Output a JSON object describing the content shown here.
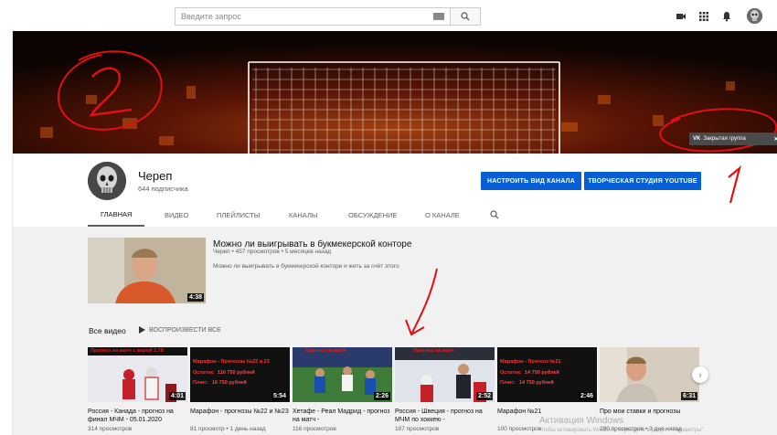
{
  "search": {
    "placeholder": "Введите запрос"
  },
  "icons": {
    "keyboard": "keyboard-icon",
    "search": "search-icon",
    "camera": "video-camera-icon",
    "apps": "apps-grid-icon",
    "bell": "bell-icon"
  },
  "banner": {
    "annotation_number": "2",
    "closed_group": "Закрытая группа"
  },
  "channel": {
    "name": "Череп",
    "subscribers": "644 подписчика",
    "customize_btn": "НАСТРОИТЬ ВИД КАНАЛА",
    "studio_btn": "ТВОРЧЕСКАЯ СТУДИЯ YOUTUBE",
    "annotation_number": "1"
  },
  "tabs": [
    "ГЛАВНАЯ",
    "ВИДЕО",
    "ПЛЕЙЛИСТЫ",
    "КАНАЛЫ",
    "ОБСУЖДЕНИЕ",
    "О КАНАЛЕ"
  ],
  "featured": {
    "title": "Можно ли выигрывать в букмекерской конторе",
    "meta": "Череп • 457 просмотров • 5 месяцев назад",
    "description": "Можно ли выигрывать в букмекерской конторе и жить за счёт этого",
    "duration": "4:38"
  },
  "all_videos": {
    "title": "Все видео",
    "play_all": "ВОСПРОИЗВЕСТИ ВСЕ"
  },
  "videos": [
    {
      "title": "Россия - Канада - прогноз на финал МЧМ - 05.01.2020",
      "meta": "314 просмотров",
      "duration": "4:01",
      "overlay": "Прогноз на матч с вирой 1.78"
    },
    {
      "title": "Марафон - прогнозы №22 и №23",
      "meta": "81 просмотр • 1 день назад",
      "duration": "5:54",
      "overlay": "Марафон - Прогнозы №22 и 23",
      "line1": "Остаток:",
      "val1": "116 750 рублей",
      "line2": "Плюс:",
      "val2": "16 750 рублей"
    },
    {
      "title": "Хетафе - Реал Мадрид - прогноз на матч -",
      "meta": "116 просмотров",
      "duration": "2:26",
      "overlay": "Прогноз на матч"
    },
    {
      "title": "Россия - Швеция - прогноз на МЧМ по хоккею -",
      "meta": "187 просмотров",
      "duration": "2:52",
      "overlay": "Прогноз на матч"
    },
    {
      "title": "Марафон №21",
      "meta": "100 просмотров",
      "duration": "2:46",
      "overlay": "Марафон - Прогноз №21",
      "line1": "Остаток:",
      "val1": "14 750 рублей",
      "line2": "Плюс:",
      "val2": "14 750 рублей"
    },
    {
      "title": "Про мои ставки и прогнозы",
      "meta": "290 просмотров • 3 дня назад",
      "duration": "6:31"
    }
  ],
  "watermark": {
    "line1": "Активация Windows",
    "line2": "Чтобы активировать Windows, перейдите в раздел \"Параметры\"."
  }
}
